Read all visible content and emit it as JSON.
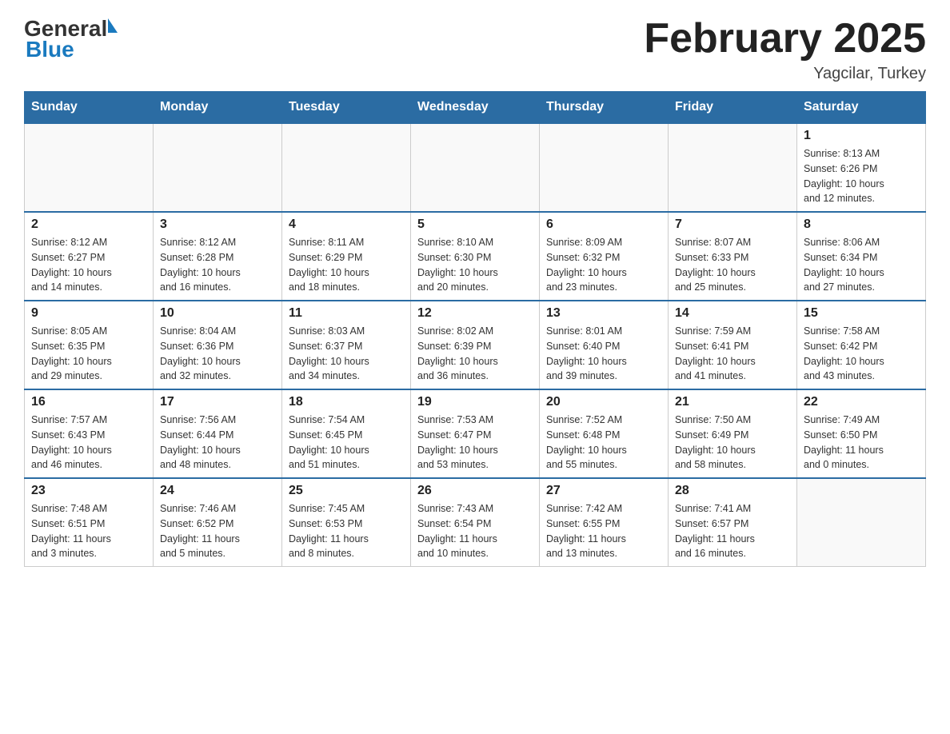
{
  "header": {
    "logo_general": "General",
    "logo_blue": "Blue",
    "title": "February 2025",
    "location": "Yagcilar, Turkey"
  },
  "days_of_week": [
    "Sunday",
    "Monday",
    "Tuesday",
    "Wednesday",
    "Thursday",
    "Friday",
    "Saturday"
  ],
  "weeks": [
    [
      {
        "day": "",
        "info": ""
      },
      {
        "day": "",
        "info": ""
      },
      {
        "day": "",
        "info": ""
      },
      {
        "day": "",
        "info": ""
      },
      {
        "day": "",
        "info": ""
      },
      {
        "day": "",
        "info": ""
      },
      {
        "day": "1",
        "info": "Sunrise: 8:13 AM\nSunset: 6:26 PM\nDaylight: 10 hours\nand 12 minutes."
      }
    ],
    [
      {
        "day": "2",
        "info": "Sunrise: 8:12 AM\nSunset: 6:27 PM\nDaylight: 10 hours\nand 14 minutes."
      },
      {
        "day": "3",
        "info": "Sunrise: 8:12 AM\nSunset: 6:28 PM\nDaylight: 10 hours\nand 16 minutes."
      },
      {
        "day": "4",
        "info": "Sunrise: 8:11 AM\nSunset: 6:29 PM\nDaylight: 10 hours\nand 18 minutes."
      },
      {
        "day": "5",
        "info": "Sunrise: 8:10 AM\nSunset: 6:30 PM\nDaylight: 10 hours\nand 20 minutes."
      },
      {
        "day": "6",
        "info": "Sunrise: 8:09 AM\nSunset: 6:32 PM\nDaylight: 10 hours\nand 23 minutes."
      },
      {
        "day": "7",
        "info": "Sunrise: 8:07 AM\nSunset: 6:33 PM\nDaylight: 10 hours\nand 25 minutes."
      },
      {
        "day": "8",
        "info": "Sunrise: 8:06 AM\nSunset: 6:34 PM\nDaylight: 10 hours\nand 27 minutes."
      }
    ],
    [
      {
        "day": "9",
        "info": "Sunrise: 8:05 AM\nSunset: 6:35 PM\nDaylight: 10 hours\nand 29 minutes."
      },
      {
        "day": "10",
        "info": "Sunrise: 8:04 AM\nSunset: 6:36 PM\nDaylight: 10 hours\nand 32 minutes."
      },
      {
        "day": "11",
        "info": "Sunrise: 8:03 AM\nSunset: 6:37 PM\nDaylight: 10 hours\nand 34 minutes."
      },
      {
        "day": "12",
        "info": "Sunrise: 8:02 AM\nSunset: 6:39 PM\nDaylight: 10 hours\nand 36 minutes."
      },
      {
        "day": "13",
        "info": "Sunrise: 8:01 AM\nSunset: 6:40 PM\nDaylight: 10 hours\nand 39 minutes."
      },
      {
        "day": "14",
        "info": "Sunrise: 7:59 AM\nSunset: 6:41 PM\nDaylight: 10 hours\nand 41 minutes."
      },
      {
        "day": "15",
        "info": "Sunrise: 7:58 AM\nSunset: 6:42 PM\nDaylight: 10 hours\nand 43 minutes."
      }
    ],
    [
      {
        "day": "16",
        "info": "Sunrise: 7:57 AM\nSunset: 6:43 PM\nDaylight: 10 hours\nand 46 minutes."
      },
      {
        "day": "17",
        "info": "Sunrise: 7:56 AM\nSunset: 6:44 PM\nDaylight: 10 hours\nand 48 minutes."
      },
      {
        "day": "18",
        "info": "Sunrise: 7:54 AM\nSunset: 6:45 PM\nDaylight: 10 hours\nand 51 minutes."
      },
      {
        "day": "19",
        "info": "Sunrise: 7:53 AM\nSunset: 6:47 PM\nDaylight: 10 hours\nand 53 minutes."
      },
      {
        "day": "20",
        "info": "Sunrise: 7:52 AM\nSunset: 6:48 PM\nDaylight: 10 hours\nand 55 minutes."
      },
      {
        "day": "21",
        "info": "Sunrise: 7:50 AM\nSunset: 6:49 PM\nDaylight: 10 hours\nand 58 minutes."
      },
      {
        "day": "22",
        "info": "Sunrise: 7:49 AM\nSunset: 6:50 PM\nDaylight: 11 hours\nand 0 minutes."
      }
    ],
    [
      {
        "day": "23",
        "info": "Sunrise: 7:48 AM\nSunset: 6:51 PM\nDaylight: 11 hours\nand 3 minutes."
      },
      {
        "day": "24",
        "info": "Sunrise: 7:46 AM\nSunset: 6:52 PM\nDaylight: 11 hours\nand 5 minutes."
      },
      {
        "day": "25",
        "info": "Sunrise: 7:45 AM\nSunset: 6:53 PM\nDaylight: 11 hours\nand 8 minutes."
      },
      {
        "day": "26",
        "info": "Sunrise: 7:43 AM\nSunset: 6:54 PM\nDaylight: 11 hours\nand 10 minutes."
      },
      {
        "day": "27",
        "info": "Sunrise: 7:42 AM\nSunset: 6:55 PM\nDaylight: 11 hours\nand 13 minutes."
      },
      {
        "day": "28",
        "info": "Sunrise: 7:41 AM\nSunset: 6:57 PM\nDaylight: 11 hours\nand 16 minutes."
      },
      {
        "day": "",
        "info": ""
      }
    ]
  ]
}
